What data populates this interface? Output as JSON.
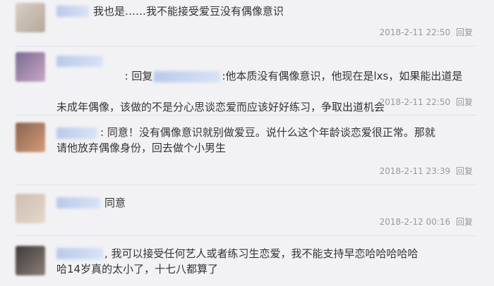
{
  "comments": [
    {
      "text": "我也是……我不能接受爱豆没有偶像意识",
      "time": "2018-2-11 22:50",
      "reply_label": "回复",
      "avatar_colors": [
        "#d8cfc6",
        "#b7a79a"
      ]
    },
    {
      "reply_prefix": ": 回复",
      "reply_suffix": ":他本质没有偶像意识，他现在是lxs，如果能出道是",
      "text_line2": "未成年偶像，该做的不是分心思谈恋爱而应该好好练习，争取出道机会",
      "time": "2018-2-11 22:50",
      "reply_label": "回复",
      "avatar_colors": [
        "#7a6a92",
        "#c9a7c4"
      ]
    },
    {
      "text": ": 同意！没有偶像意识就别做爱豆。说什么这个年龄谈恋爱很正常。那就\n请他放弃偶像身份，回去做个小男生",
      "time": "2018-2-11 23:39",
      "reply_label": "回复",
      "avatar_colors": [
        "#8a6450",
        "#d49b78"
      ]
    },
    {
      "text": "同意",
      "time": "2018-2-12 00:16",
      "reply_label": "回复",
      "avatar_colors": [
        "#cdbdb0",
        "#e6d8cc"
      ]
    },
    {
      "text": ", 我可以接受任何艺人或者练习生恋爱，我不能支持早恋哈哈哈哈哈\n哈14岁真的太小了，十七八都算了",
      "avatar_colors": [
        "#3e3a3a",
        "#8c7e78"
      ]
    }
  ]
}
